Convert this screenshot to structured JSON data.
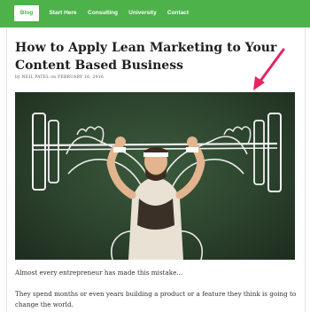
{
  "nav": {
    "items": [
      {
        "label": "Blog",
        "active": true
      },
      {
        "label": "Start Here"
      },
      {
        "label": "Consulting"
      },
      {
        "label": "University"
      },
      {
        "label": "Contact"
      }
    ]
  },
  "article": {
    "title": "How to Apply Lean Marketing to Your Content Based Business",
    "byline": "by NEIL PATEL on FEBRUARY 16, 2016",
    "paragraphs": [
      "Almost every entrepreneur has made this mistake...",
      "They spend months or even years building a product or a feature they think is going to change the world."
    ]
  },
  "colors": {
    "nav_bg": "#4db24a",
    "arrow": "#e8245f"
  },
  "icons": {
    "annotation": "pink-arrow-icon"
  }
}
